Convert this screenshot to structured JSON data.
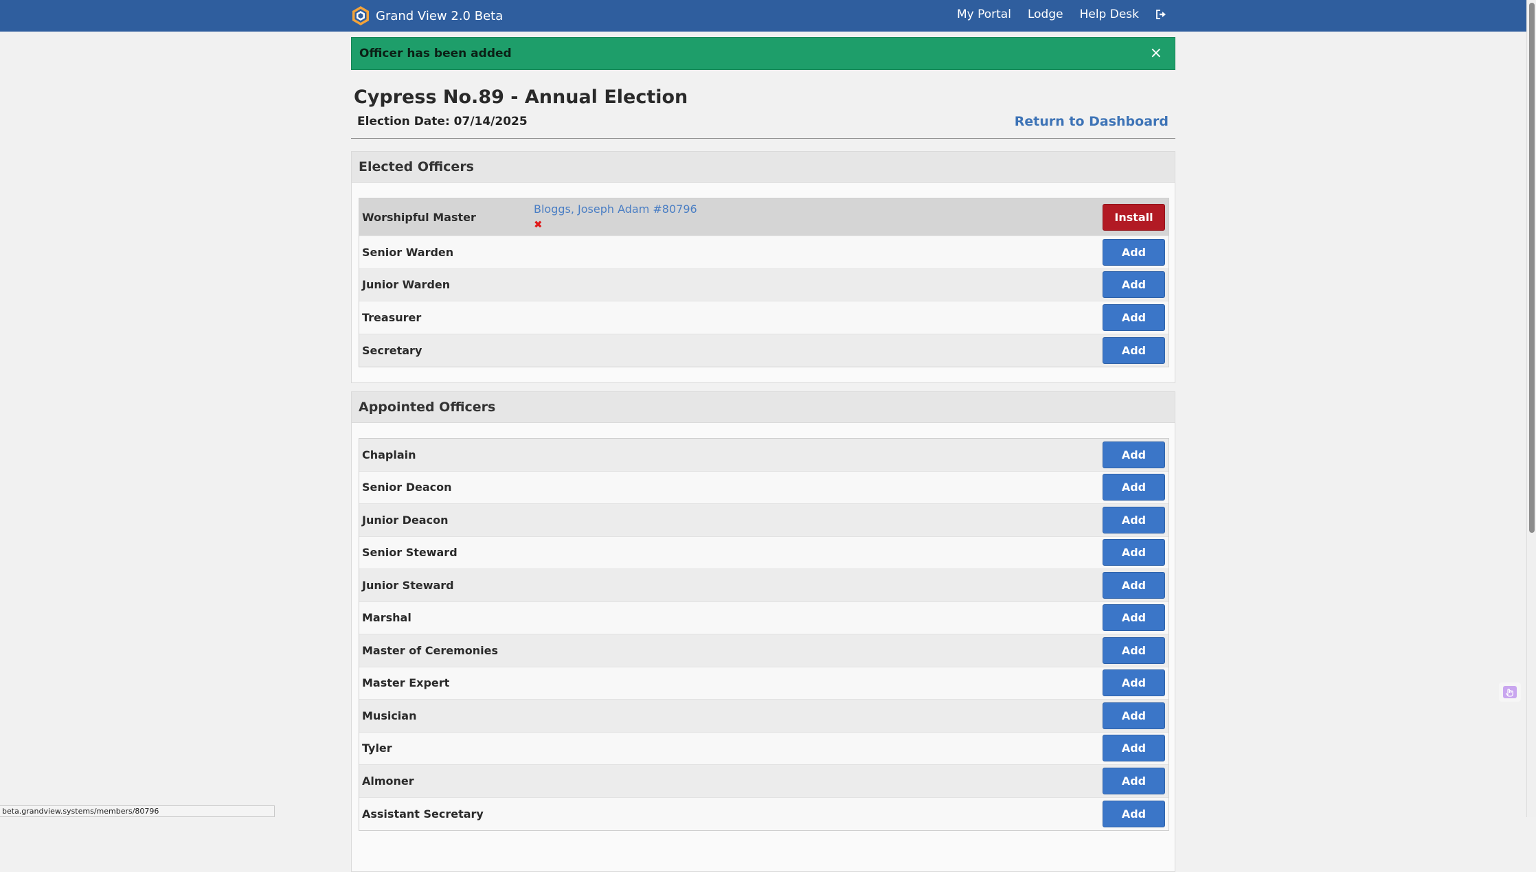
{
  "nav": {
    "brand": "Grand View 2.0 Beta",
    "links": [
      "My Portal",
      "Lodge",
      "Help Desk"
    ],
    "logout_icon": "sign-out-icon"
  },
  "alert": {
    "message": "Officer has been added",
    "close": "×",
    "color": "#1e9e6a"
  },
  "header": {
    "title": "Cypress No.89 - Annual Election",
    "election_date": "Election Date: 07/14/2025",
    "return_link": "Return to Dashboard"
  },
  "elected": {
    "heading": "Elected Officers",
    "rows": [
      {
        "label": "Worshipful Master",
        "member": "Bloggs, Joseph Adam #80796",
        "action": "Install"
      },
      {
        "label": "Senior Warden",
        "action": "Add"
      },
      {
        "label": "Junior Warden",
        "action": "Add"
      },
      {
        "label": "Treasurer",
        "action": "Add"
      },
      {
        "label": "Secretary",
        "action": "Add"
      }
    ]
  },
  "appointed": {
    "heading": "Appointed Officers",
    "rows": [
      {
        "label": "Chaplain",
        "action": "Add"
      },
      {
        "label": "Senior Deacon",
        "action": "Add"
      },
      {
        "label": "Junior Deacon",
        "action": "Add"
      },
      {
        "label": "Senior Steward",
        "action": "Add"
      },
      {
        "label": "Junior Steward",
        "action": "Add"
      },
      {
        "label": "Marshal",
        "action": "Add"
      },
      {
        "label": "Master of Ceremonies",
        "action": "Add"
      },
      {
        "label": "Master Expert",
        "action": "Add"
      },
      {
        "label": "Musician",
        "action": "Add"
      },
      {
        "label": "Tyler",
        "action": "Add"
      },
      {
        "label": "Almoner",
        "action": "Add"
      },
      {
        "label": "Assistant Secretary",
        "action": "Add"
      }
    ]
  },
  "status_url": "beta.grandview.systems/members/80796",
  "colors": {
    "navbar": "#2f5e9e",
    "add_button": "#3b76c8",
    "install_button": "#b21a24",
    "link": "#3d73b6"
  }
}
